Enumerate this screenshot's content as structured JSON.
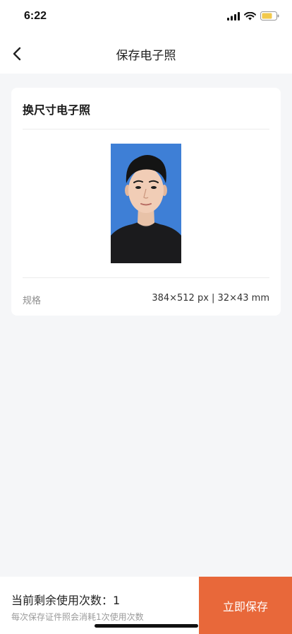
{
  "status_bar": {
    "time": "6:22"
  },
  "nav": {
    "title": "保存电子照"
  },
  "card": {
    "title": "换尺寸电子照",
    "spec_label": "规格",
    "spec_value": "384×512 px | 32×43 mm"
  },
  "bottom": {
    "remaining": "当前剩余使用次数：1",
    "consume_note": "每次保存证件照会消耗1次使用次数",
    "save_label": "立即保存"
  },
  "colors": {
    "accent": "#e8683a",
    "photo_background": "#3e7fd6",
    "page_background": "#f5f6f8"
  },
  "icons": [
    "chevron-left-icon",
    "signal-icon",
    "wifi-icon",
    "battery-icon"
  ]
}
